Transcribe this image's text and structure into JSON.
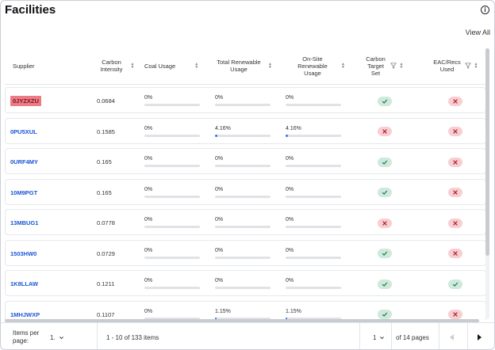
{
  "title": "Facilities",
  "view_all_label": "View All",
  "columns": {
    "supplier": "Supplier",
    "carbon_intensity": "Carbon Intensity",
    "coal_usage": "Coal Usage",
    "total_renewable": "Total Renewable Usage",
    "onsite_renewable": "On-Site Renewable Usage",
    "carbon_target": "Carbon Target Set",
    "eac": "EAC/Recs Used"
  },
  "rows": [
    {
      "supplier": "0JYZXZU",
      "highlight": true,
      "intensity": "0.0684",
      "coal": "0%",
      "coal_pct": 0,
      "total": "0%",
      "total_pct": 0,
      "onsite": "0%",
      "onsite_pct": 0,
      "target": "yes",
      "eac": "no"
    },
    {
      "supplier": "0PU5XUL",
      "highlight": false,
      "intensity": "0.1585",
      "coal": "0%",
      "coal_pct": 0,
      "total": "4.16%",
      "total_pct": 4.16,
      "onsite": "4.16%",
      "onsite_pct": 4.16,
      "target": "no",
      "eac": "no"
    },
    {
      "supplier": "0URF4MY",
      "highlight": false,
      "intensity": "0.165",
      "coal": "0%",
      "coal_pct": 0,
      "total": "0%",
      "total_pct": 0,
      "onsite": "0%",
      "onsite_pct": 0,
      "target": "yes",
      "eac": "no"
    },
    {
      "supplier": "10M9PGT",
      "highlight": false,
      "intensity": "0.165",
      "coal": "0%",
      "coal_pct": 0,
      "total": "0%",
      "total_pct": 0,
      "onsite": "0%",
      "onsite_pct": 0,
      "target": "yes",
      "eac": "no"
    },
    {
      "supplier": "13MBUG1",
      "highlight": false,
      "intensity": "0.0778",
      "coal": "0%",
      "coal_pct": 0,
      "total": "0%",
      "total_pct": 0,
      "onsite": "0%",
      "onsite_pct": 0,
      "target": "no",
      "eac": "no"
    },
    {
      "supplier": "1503HW0",
      "highlight": false,
      "intensity": "0.0729",
      "coal": "0%",
      "coal_pct": 0,
      "total": "0%",
      "total_pct": 0,
      "onsite": "0%",
      "onsite_pct": 0,
      "target": "yes",
      "eac": "no"
    },
    {
      "supplier": "1K8LLAW",
      "highlight": false,
      "intensity": "0.1211",
      "coal": "0%",
      "coal_pct": 0,
      "total": "0%",
      "total_pct": 0,
      "onsite": "0%",
      "onsite_pct": 0,
      "target": "yes",
      "eac": "yes"
    },
    {
      "supplier": "1MHJWXP",
      "highlight": false,
      "intensity": "0.1107",
      "coal": "0%",
      "coal_pct": 0,
      "total": "1.15%",
      "total_pct": 1.15,
      "onsite": "1.15%",
      "onsite_pct": 1.15,
      "target": "yes",
      "eac": "no"
    }
  ],
  "footer": {
    "items_per_page_label": "Items per page:",
    "items_per_page_value": "1.",
    "range_text": "1 - 10 of 133 items",
    "page_value": "1",
    "pages_text": "of 14 pages"
  },
  "colors": {
    "accent": "#1a56d6",
    "yes_bg": "#cfe9dc",
    "yes_fg": "#1e7a4e",
    "no_bg": "#f7cfd2",
    "no_fg": "#b3242f",
    "highlight": "#ec7b86"
  }
}
